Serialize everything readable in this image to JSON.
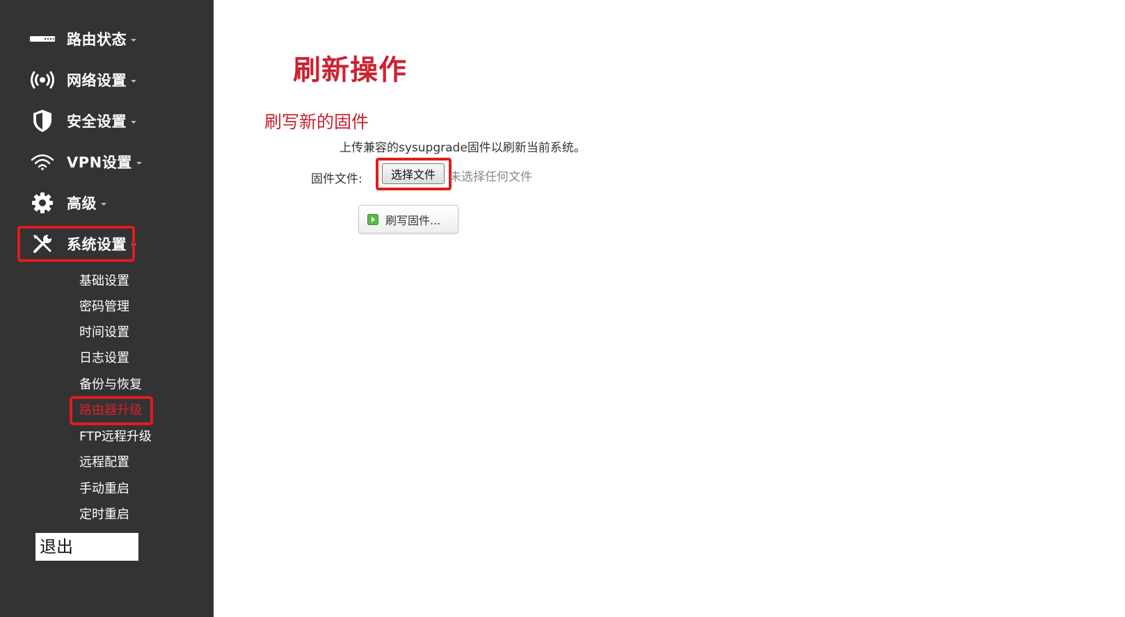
{
  "sidebar": {
    "menu": [
      {
        "label": "路由状态",
        "icon": "router-icon"
      },
      {
        "label": "网络设置",
        "icon": "wireless-signal-icon"
      },
      {
        "label": "安全设置",
        "icon": "shield-icon"
      },
      {
        "label": "VPN设置",
        "icon": "wifi-icon"
      },
      {
        "label": "高级",
        "icon": "gear-icon"
      },
      {
        "label": "系统设置",
        "icon": "tools-icon"
      }
    ],
    "submenu": [
      {
        "label": "基础设置"
      },
      {
        "label": "密码管理"
      },
      {
        "label": "时间设置"
      },
      {
        "label": "日志设置"
      },
      {
        "label": "备份与恢复"
      },
      {
        "label": "路由器升级",
        "active": true
      },
      {
        "label": "FTP远程升级"
      },
      {
        "label": "远程配置"
      },
      {
        "label": "手动重启"
      },
      {
        "label": "定时重启"
      }
    ],
    "logout_label": "退出"
  },
  "main": {
    "title": "刷新操作",
    "section_title": "刷写新的固件",
    "description": "上传兼容的sysupgrade固件以刷新当前系统。",
    "file_label": "固件文件:",
    "choose_file_label": "选择文件",
    "no_file_text": "未选择任何文件",
    "flash_button_label": "刷写固件..."
  },
  "colors": {
    "sidebar_bg": "#333333",
    "accent_red": "#cc2232",
    "highlight_border": "#e11c1c"
  }
}
